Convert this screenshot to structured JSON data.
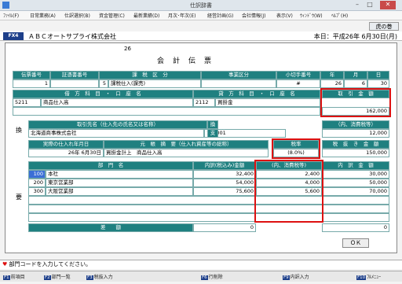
{
  "window": {
    "title": "仕訳辞書"
  },
  "menu": [
    "ﾌｧｲﾙ(F)",
    "日常業務(A)",
    "仕訳選択(B)",
    "資金管理(C)",
    "最新業績(D)",
    "月次･年次(E)",
    "経営計画(G)",
    "会社情報(J)",
    "表示(V)",
    "ｳｨﾝﾄﾞｳ(W)",
    "ﾍﾙﾌﾟ(H)"
  ],
  "corner_button": "虎の巻",
  "header": {
    "badge": "FX4",
    "company": "ＡＢＣオートサプライ株式会社",
    "today": "本日：平成26年 6月30日(月)"
  },
  "doc": {
    "number": "26",
    "title": "会　計　伝　票",
    "top_headers": [
      "伝票番号",
      "証憑書番号",
      "課　税　区　分",
      "事業区分",
      "小切手番号",
      "年",
      "月",
      "日"
    ],
    "top_values": [
      "1",
      "",
      "5",
      "課税仕入(課売)",
      "",
      "",
      "#",
      "26",
      "6",
      "30"
    ],
    "acct_headers": [
      "借　方　科　目　・　口　座　名",
      "貸　方　科　目　・　口　座　名",
      "取　引　金　額"
    ],
    "debit_code": "5211",
    "debit_name": "商品仕入高",
    "credit_code": "2112",
    "credit_name": "買掛金",
    "amount": "162,000",
    "partner_label": "取引先名（仕入先の氏名又は名称）",
    "partner_name": "北海道商事株式会社",
    "partner_code": "100001",
    "kan": "換",
    "shi": "支",
    "yo": "要",
    "tax_inc_label": "（内、消費税等）",
    "tax_inc_value": "12,000",
    "date_label": "実際の仕入れ年月日",
    "summary_label": "元　帳　摘　要（仕入れ資産等の総称）",
    "rate_label": "税率",
    "net_label": "税　抜　き　金　額",
    "date_value": "26年 6月30日",
    "summary_value": "買掛金計上　商品仕入高",
    "rate_value": "(8.0%)",
    "net_value": "150,000",
    "dept_headers": [
      "部　門　名",
      "内訳(税込み)金額",
      "(内、消費税等)",
      "内　訳　金　額"
    ],
    "rows": [
      {
        "code": "100",
        "name": "本社",
        "gross": "32,400",
        "tax": "2,400",
        "net": "30,000"
      },
      {
        "code": "200",
        "name": "東京営業部",
        "gross": "54,000",
        "tax": "4,000",
        "net": "50,000"
      },
      {
        "code": "300",
        "name": "大阪営業部",
        "gross": "75,600",
        "tax": "5,600",
        "net": "70,000"
      }
    ],
    "diff_label": "差　　額",
    "diff_value": "0",
    "diff_value2": "0"
  },
  "ok_button": "ＯＫ",
  "status": "部門コードを入力してください。",
  "fkeys": [
    {
      "key": "F1",
      "label": "前項目"
    },
    {
      "key": "F2",
      "label": "部門一覧"
    },
    {
      "key": "F3",
      "label": "税抜入力"
    },
    {
      "key": "F6",
      "label": "行削除"
    },
    {
      "key": "F9",
      "label": "内訳入力"
    },
    {
      "key": "F10",
      "label": "ﾌﾙﾒﾆｭｰ"
    }
  ]
}
